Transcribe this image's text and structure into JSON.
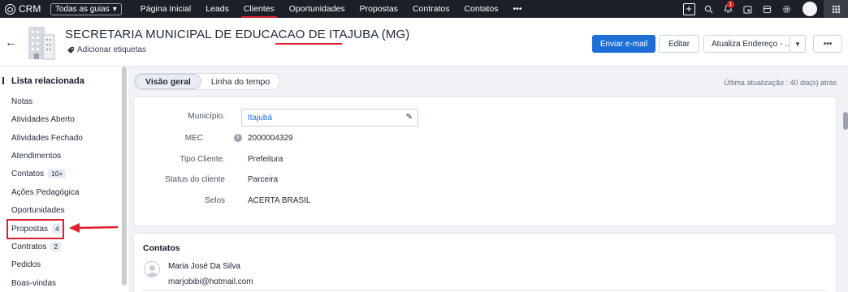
{
  "topnav": {
    "app_name": "CRM",
    "guides_label": "Todas as guias",
    "menu": [
      "Página Inicial",
      "Leads",
      "Clientes",
      "Oportunidades",
      "Propostas",
      "Contratos",
      "Contatos",
      "•••"
    ],
    "active_menu": "Clientes",
    "notification_count": "1",
    "icons": [
      "plus-icon",
      "search-icon",
      "bell-icon",
      "calendar-icon",
      "store-icon",
      "gear-icon",
      "avatar",
      "apps-grid-icon"
    ]
  },
  "header": {
    "title": "SECRETARIA MUNICIPAL DE EDUCACAO DE ITAJUBA (MG)",
    "tags_label": "Adicionar etiquetas",
    "buttons": {
      "email": "Enviar e-mail",
      "edit": "Editar",
      "update": "Atualiza Endereço - ...",
      "more": "•••"
    }
  },
  "sidebar": {
    "title": "Lista relacionada",
    "items": [
      {
        "label": "Notas",
        "badge": ""
      },
      {
        "label": "Atividades Aberto",
        "badge": ""
      },
      {
        "label": "Atividades Fechado",
        "badge": ""
      },
      {
        "label": "Atendimentos",
        "badge": ""
      },
      {
        "label": "Contatos",
        "badge": "10+"
      },
      {
        "label": "Ações Pedagógica",
        "badge": ""
      },
      {
        "label": "Oportunidades",
        "badge": ""
      },
      {
        "label": "Propostas",
        "badge": "4"
      },
      {
        "label": "Contratos",
        "badge": "2"
      },
      {
        "label": "Pedidos",
        "badge": ""
      },
      {
        "label": "Boas-vindas",
        "badge": ""
      }
    ]
  },
  "main": {
    "tabs": [
      "Visão geral",
      "Linha do tempo"
    ],
    "last_update": "Última atualização : 40 dia(s) atrás",
    "fields": {
      "municipio_label": "Município.",
      "municipio_value": "Itajubá",
      "mec_label": "MEC",
      "mec_value": "2000004329",
      "tipo_label": "Tipo Cliente.",
      "tipo_value": "Prefeitura",
      "status_label": "Status do cliente",
      "status_value": "Parceira",
      "selos_label": "Selos",
      "selos_value": "ACERTA BRASIL"
    },
    "contacts": {
      "title": "Contatos",
      "name": "Maria José Da Silva",
      "email": "marjobibi@hotmail.com"
    }
  },
  "colors": {
    "topbar": "#1c1f26",
    "accent_red": "#e11d2e",
    "primary_blue": "#1d6fd6"
  }
}
